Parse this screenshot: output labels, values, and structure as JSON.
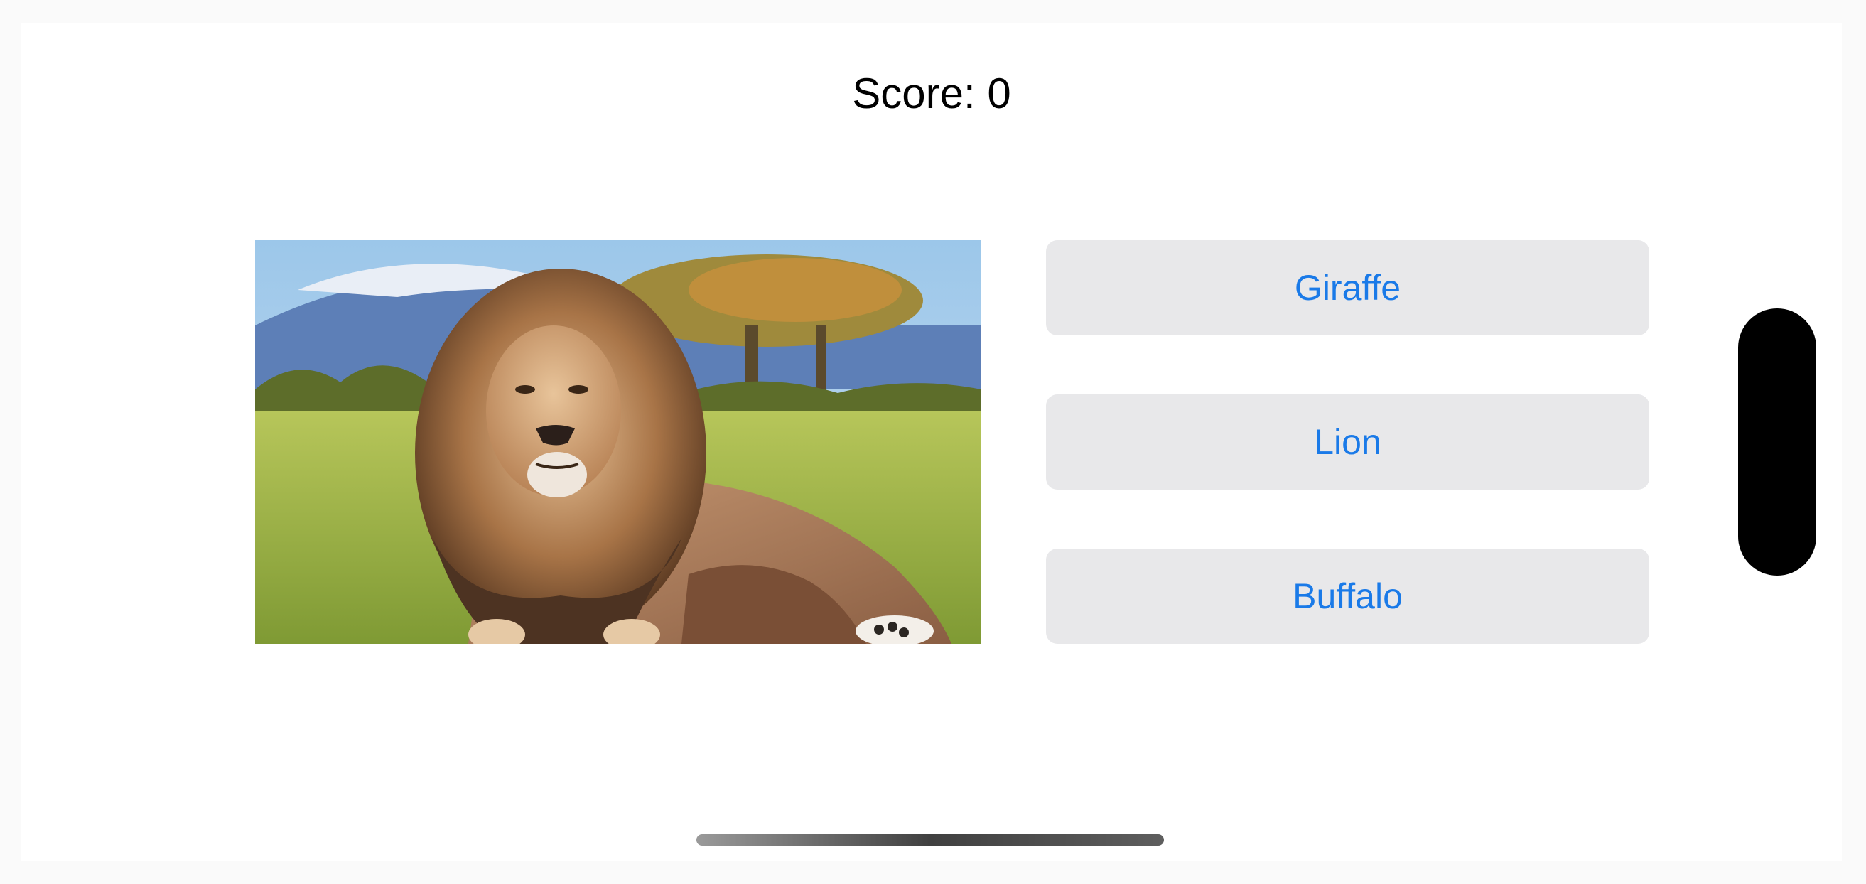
{
  "score": {
    "text": "Score: 0",
    "value": 0
  },
  "question": {
    "image": "lion-photo",
    "image_description_icon": "lion-on-savanna"
  },
  "options": [
    {
      "label": "Giraffe"
    },
    {
      "label": "Lion"
    },
    {
      "label": "Buffalo"
    }
  ],
  "colors": {
    "button_bg": "#e8e8ea",
    "button_text": "#1a7ae8",
    "background": "#ffffff"
  }
}
